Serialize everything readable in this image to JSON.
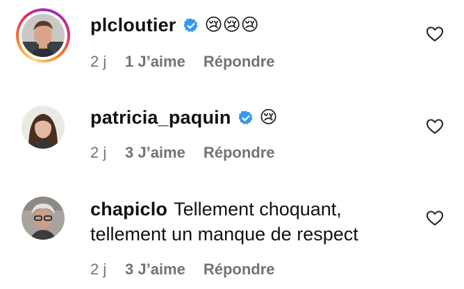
{
  "comments": [
    {
      "username": "plcloutier",
      "verified": true,
      "text": "",
      "emoji": "😢😢😢",
      "time": "2 j",
      "likes": "1 J’aime",
      "reply": "Répondre",
      "has_story_ring": true
    },
    {
      "username": "patricia_paquin",
      "verified": true,
      "text": "",
      "emoji": "😢",
      "time": "2 j",
      "likes": "3 J’aime",
      "reply": "Répondre",
      "has_story_ring": false
    },
    {
      "username": "chapiclo",
      "verified": false,
      "text": "Tellement choquant,",
      "text_line2": "tellement un manque de respect",
      "emoji": "",
      "time": "2 j",
      "likes": "3 J’aime",
      "reply": "Répondre",
      "has_story_ring": false
    }
  ],
  "colors": {
    "verified_badge": "#3897f0",
    "meta_text": "#737373",
    "primary_text": "#111111"
  },
  "icons": {
    "verified": "verified-badge-icon",
    "like": "heart-outline-icon"
  }
}
